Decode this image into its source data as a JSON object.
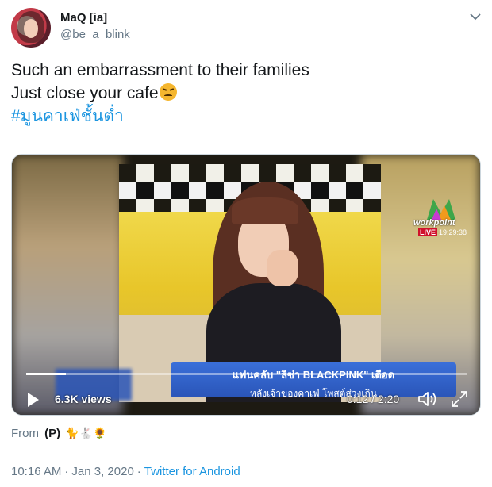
{
  "user": {
    "display_name": "MaQ [ia]",
    "handle": "@be_a_blink"
  },
  "tweet": {
    "line1": "Such an embarrassment to their families",
    "line2": "Just close your cafe",
    "hashtag": "#มูนคาเฟ่ชั้นต่ำ"
  },
  "video": {
    "views": "6.3K views",
    "time": "0:12 / 2:20",
    "progress_fraction": 0.09,
    "channel_logo_text": "workpoint",
    "live_label": "LIVE",
    "live_clock": "19:29:38",
    "caption_line1": "แฟนคลับ \"ลิซ่า BLACKPINK\" เดือด",
    "caption_line2": "หลังเจ้าของคาเฟ่ โพสต์ส่วงเกิน"
  },
  "attribution": {
    "label": "From",
    "source": "(P)",
    "emojis": "🐈🐇🌻"
  },
  "footer": {
    "time": "10:16 AM",
    "date": "Jan 3, 2020",
    "source": "Twitter for Android"
  },
  "colors": {
    "link": "#1b95e0",
    "secondary": "#657786",
    "primary_text": "#14171a"
  }
}
